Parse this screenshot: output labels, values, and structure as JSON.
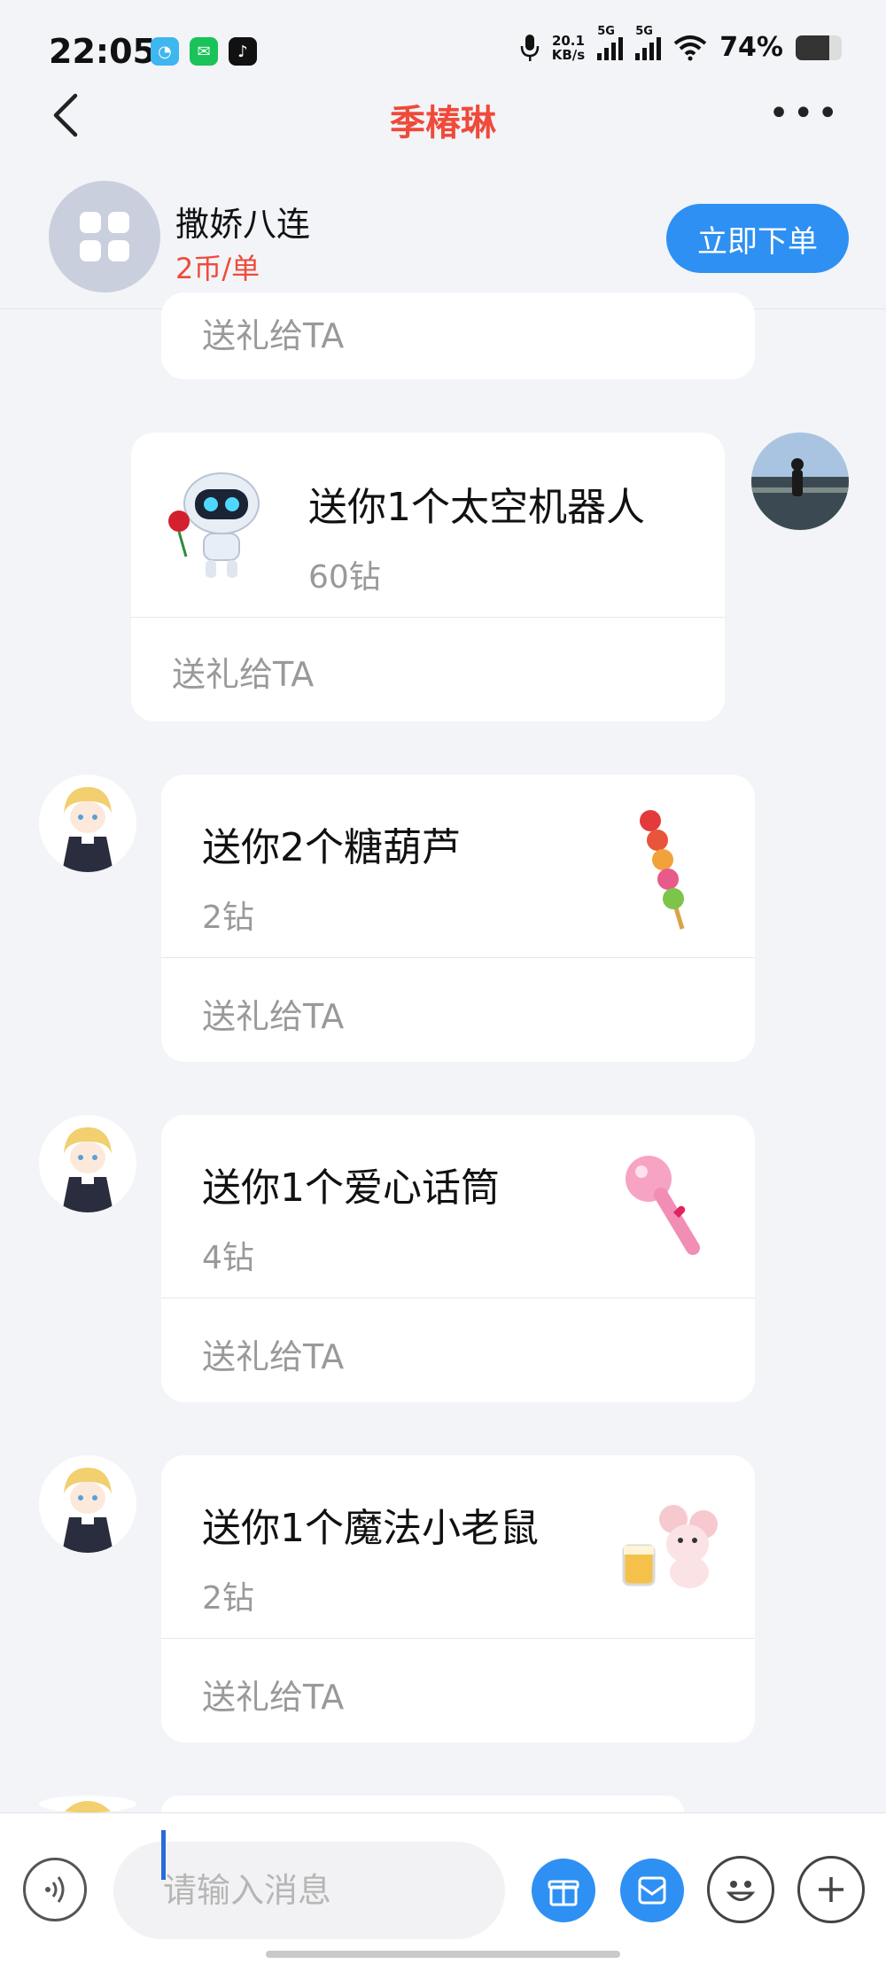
{
  "status": {
    "time": "22:05",
    "net_speed_value": "20.1",
    "net_speed_unit": "KB/s",
    "signal1_label": "5G",
    "signal2_label": "5G",
    "battery": "74%"
  },
  "header": {
    "title": "季椿琳"
  },
  "service": {
    "name": "撒娇八连",
    "price": "2币/单",
    "order_label": "立即下单"
  },
  "messages": [
    {
      "send_label": "送礼给TA"
    },
    {
      "gift": "送你1个太空机器人",
      "price": "60钻",
      "send_label": "送礼给TA",
      "icon": "robot-gift-icon"
    },
    {
      "gift": "送你2个糖葫芦",
      "price": "2钻",
      "send_label": "送礼给TA",
      "icon": "candied-haws-icon"
    },
    {
      "gift": "送你1个爱心话筒",
      "price": "4钻",
      "send_label": "送礼给TA",
      "icon": "heart-microphone-icon"
    },
    {
      "gift": "送你1个魔法小老鼠",
      "price": "2钻",
      "send_label": "送礼给TA",
      "icon": "magic-mouse-icon"
    }
  ],
  "input": {
    "placeholder": "请输入消息"
  },
  "colors": {
    "accent": "#2e90f3",
    "title": "#ef4a3a",
    "background": "#f2f4f8"
  }
}
